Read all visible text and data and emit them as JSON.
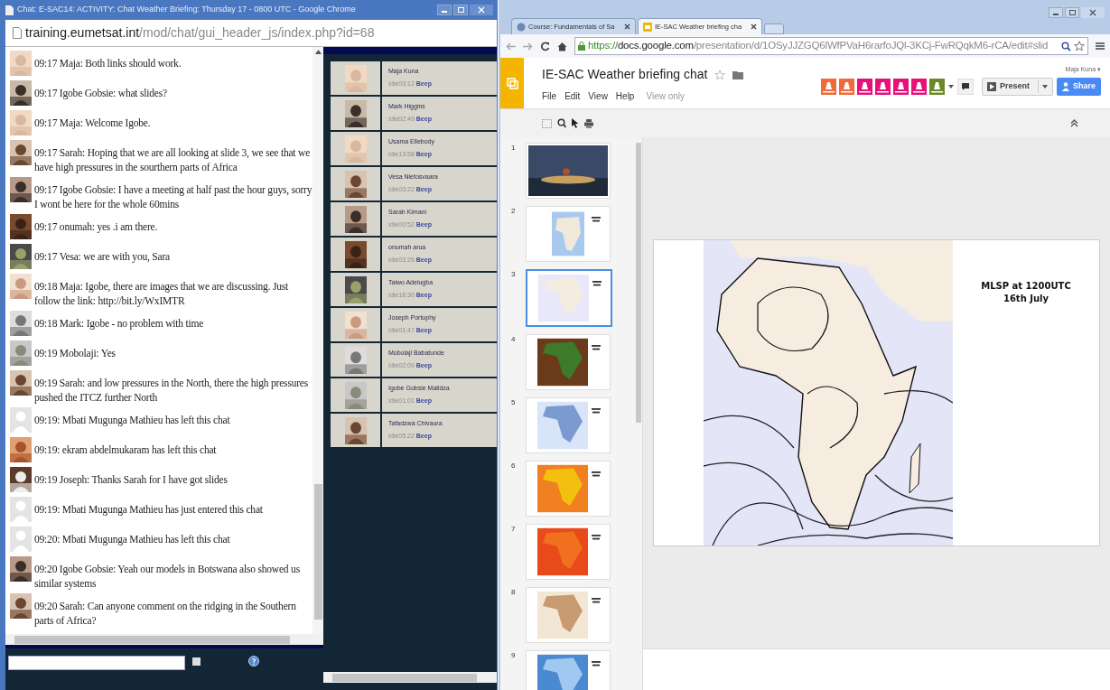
{
  "chat_window": {
    "title": "Chat: E-SAC14: ACTIVITY: Chat Weather Briefing: Thursday 17 - 0800 UTC - Google Chrome",
    "url": {
      "host": "training.eumetsat.int",
      "path": "/mod/chat/gui_header_js/index.php?id=68"
    },
    "messages": [
      {
        "text": "09:17 Maja: Both links should work."
      },
      {
        "text": "09:17 Igobe Gobsie: what slides?"
      },
      {
        "text": "09:17 Maja: Welcome Igobe."
      },
      {
        "text": "09:17 Sarah: Hoping that we are all looking at slide 3, we see that we have high pressures in the sourthern parts of Africa"
      },
      {
        "text": "09:17 Igobe Gobsie: I have a meeting at half past the hour guys, sorry I wont be here for the whole 60mins"
      },
      {
        "text": "09:17 onumah: yes .i am there."
      },
      {
        "text": "09:17 Vesa: we are with you, Sara"
      },
      {
        "text": "09:18 Maja: Igobe, there are images that we are discussing. Just follow the link: http://bit.ly/WxIMTR"
      },
      {
        "text": "09:18 Mark: Igobe - no problem with time"
      },
      {
        "text": "09:19 Mobolaji: Yes"
      },
      {
        "text": "09:19 Sarah: and low pressures in the North, there the high pressures pushed the ITCZ further North"
      },
      {
        "kind": "default",
        "text": "09:19: Mbati Mugunga Mathieu has left this chat"
      },
      {
        "text": "09:19: ekram abdelmukaram has left this chat"
      },
      {
        "text": "09:19 Joseph: Thanks Sarah for I have got slides"
      },
      {
        "kind": "default",
        "text": "09:19: Mbati Mugunga Mathieu has just entered this chat"
      },
      {
        "kind": "default",
        "text": "09:20: Mbati Mugunga Mathieu has left this chat"
      },
      {
        "text": "09:20 Igobe Gobsie: Yeah our models in Botswana also showed us similar systems"
      },
      {
        "text": "09:20 Sarah: Can anyone comment on the ridging in the Southern parts of Africa?"
      }
    ],
    "users": [
      {
        "name": "Maja Kuna",
        "idle": "Idle03:12",
        "beep": "Beep"
      },
      {
        "name": "Mark Higgins",
        "idle": "Idle02:49",
        "beep": "Beep"
      },
      {
        "name": "Usama Ellebody",
        "idle": "Idle13:58",
        "beep": "Beep"
      },
      {
        "name": "Vesa Nietosvaara",
        "idle": "Idle03:22",
        "beep": "Beep"
      },
      {
        "name": "Sarah Kimani",
        "idle": "Idle00:52",
        "beep": "Beep"
      },
      {
        "name": "onumah arua",
        "idle": "Idle03:26",
        "beep": "Beep"
      },
      {
        "name": "Taiwo Adelugba",
        "idle": "Idle18:30",
        "beep": "Beep"
      },
      {
        "name": "Joseph Portuphy",
        "idle": "Idle01:47",
        "beep": "Beep"
      },
      {
        "name": "Mobolaji Babatunde",
        "idle": "Idle02:09",
        "beep": "Beep"
      },
      {
        "name": "Igobe Gobsie Malidza",
        "idle": "Idle01:01",
        "beep": "Beep"
      },
      {
        "name": "Tafadzwa Chivaura",
        "idle": "Idle05:22",
        "beep": "Beep"
      }
    ],
    "input": {
      "checked": false
    }
  },
  "slides_window": {
    "tabs": [
      {
        "label": "Course: Fundamentals of Sa",
        "selected": false
      },
      {
        "label": "IE-SAC Weather briefing cha",
        "selected": true
      }
    ],
    "url": {
      "scheme": "https://",
      "host": "docs.google.com",
      "path": "/presentation/d/1OSyJJZGQ6lWfPVaH6rarfoJQl-3KCj-FwRQqkM6-rCA/edit#slid"
    },
    "doc_title": "IE-SAC Weather briefing chat",
    "menus": [
      "File",
      "Edit",
      "View",
      "Help"
    ],
    "mode": "View only",
    "user": "Maja Kuna ▾",
    "present": "Present",
    "share": "Share",
    "thumbnails": [
      {
        "number": "1",
        "selected": false
      },
      {
        "number": "2",
        "selected": false
      },
      {
        "number": "3",
        "selected": true
      },
      {
        "number": "4",
        "selected": false
      },
      {
        "number": "5",
        "selected": false
      },
      {
        "number": "6",
        "selected": false
      },
      {
        "number": "7",
        "selected": false
      },
      {
        "number": "8",
        "selected": false
      },
      {
        "number": "9",
        "selected": false
      }
    ],
    "slide": {
      "title_lines": [
        "MLSP at 1200UTC",
        "16th July"
      ]
    }
  }
}
